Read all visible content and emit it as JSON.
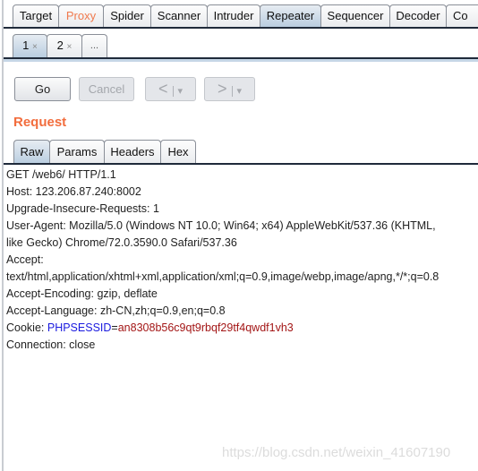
{
  "top_tabs": [
    {
      "label": "Target"
    },
    {
      "label": "Proxy"
    },
    {
      "label": "Spider"
    },
    {
      "label": "Scanner"
    },
    {
      "label": "Intruder"
    },
    {
      "label": "Repeater"
    },
    {
      "label": "Sequencer"
    },
    {
      "label": "Decoder"
    },
    {
      "label": "Co"
    }
  ],
  "selected_tab": "Repeater",
  "sub_tabs": [
    {
      "label": "1",
      "close": "×"
    },
    {
      "label": "2",
      "close": "×"
    },
    {
      "label": "..."
    }
  ],
  "buttons": {
    "go": "Go",
    "cancel": "Cancel",
    "back": "<",
    "forward": ">",
    "dropdown": "▾"
  },
  "request_title": "Request",
  "view_tabs": [
    {
      "label": "Raw"
    },
    {
      "label": "Params"
    },
    {
      "label": "Headers"
    },
    {
      "label": "Hex"
    }
  ],
  "request_lines": [
    "GET /web6/ HTTP/1.1",
    "Host: 123.206.87.240:8002",
    "Upgrade-Insecure-Requests: 1",
    "User-Agent: Mozilla/5.0 (Windows NT 10.0; Win64; x64) AppleWebKit/537.36 (KHTML,",
    "like Gecko) Chrome/72.0.3590.0 Safari/537.36",
    "Accept:",
    "text/html,application/xhtml+xml,application/xml;q=0.9,image/webp,image/apng,*/*;q=0.8",
    "Accept-Encoding: gzip, deflate",
    "Accept-Language: zh-CN,zh;q=0.9,en;q=0.8"
  ],
  "cookie": {
    "prefix": "Cookie: ",
    "name": "PHPSESSID",
    "eq": "=",
    "value": "an8308b56c9qt9rbqf29tf4qwdf1vh3"
  },
  "connection_line": "Connection: close",
  "watermark": "https://blog.csdn.net/weixin_41607190",
  "colors": {
    "accent": "#f26d3d",
    "cookie_name": "#1a1adf",
    "cookie_value": "#a31616"
  }
}
